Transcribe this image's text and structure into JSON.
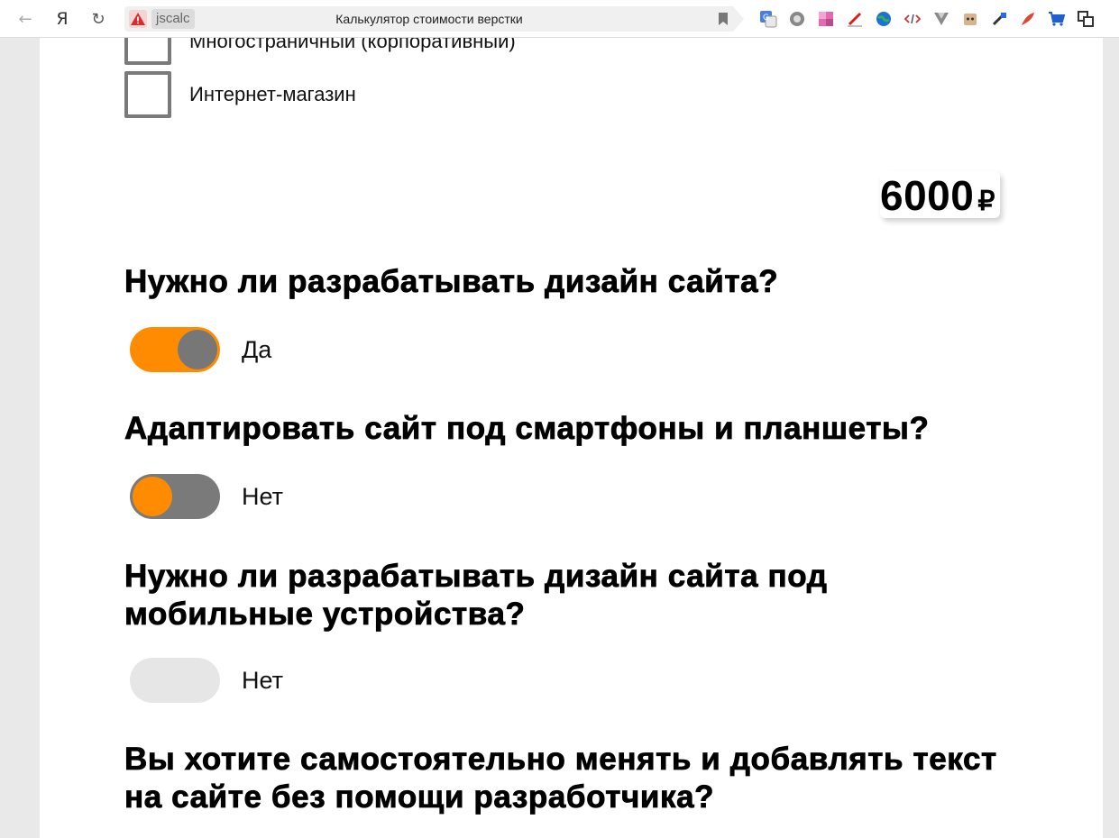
{
  "browser": {
    "tab_host": "jscalc",
    "page_title": "Калькулятор стоимости верстки",
    "nav_ya": "Я",
    "extensions": [
      "translate-icon",
      "settings-gear-icon",
      "color-palette-icon",
      "pen-icon",
      "globe-icon",
      "code-icon",
      "vue-icon",
      "robot-icon",
      "pipette-icon",
      "feather-icon",
      "cart-icon",
      "translate-alt-icon"
    ]
  },
  "options": [
    {
      "label": "Многостраничный (корпоративный)",
      "checked": false
    },
    {
      "label": "Интернет-магазин",
      "checked": false
    }
  ],
  "price": {
    "value": "6000",
    "currency": "₽"
  },
  "questions": [
    {
      "text": "Нужно ли разрабатывать дизайн сайта?",
      "toggle_label": "Да",
      "state": "on"
    },
    {
      "text": "Адаптировать сайт под смартфоны и планшеты?",
      "toggle_label": "Нет",
      "state": "off"
    },
    {
      "text": "Нужно ли разрабатывать дизайн сайта под мобильные устройства?",
      "toggle_label": "Нет",
      "state": "disabled"
    },
    {
      "text": "Вы хотите самостоятельно менять и добавлять текст на сайте без помощи разработчика?"
    }
  ],
  "colors": {
    "accent": "#ff8c00",
    "toggle_gray": "#777777",
    "disabled": "#e6e6e6"
  }
}
